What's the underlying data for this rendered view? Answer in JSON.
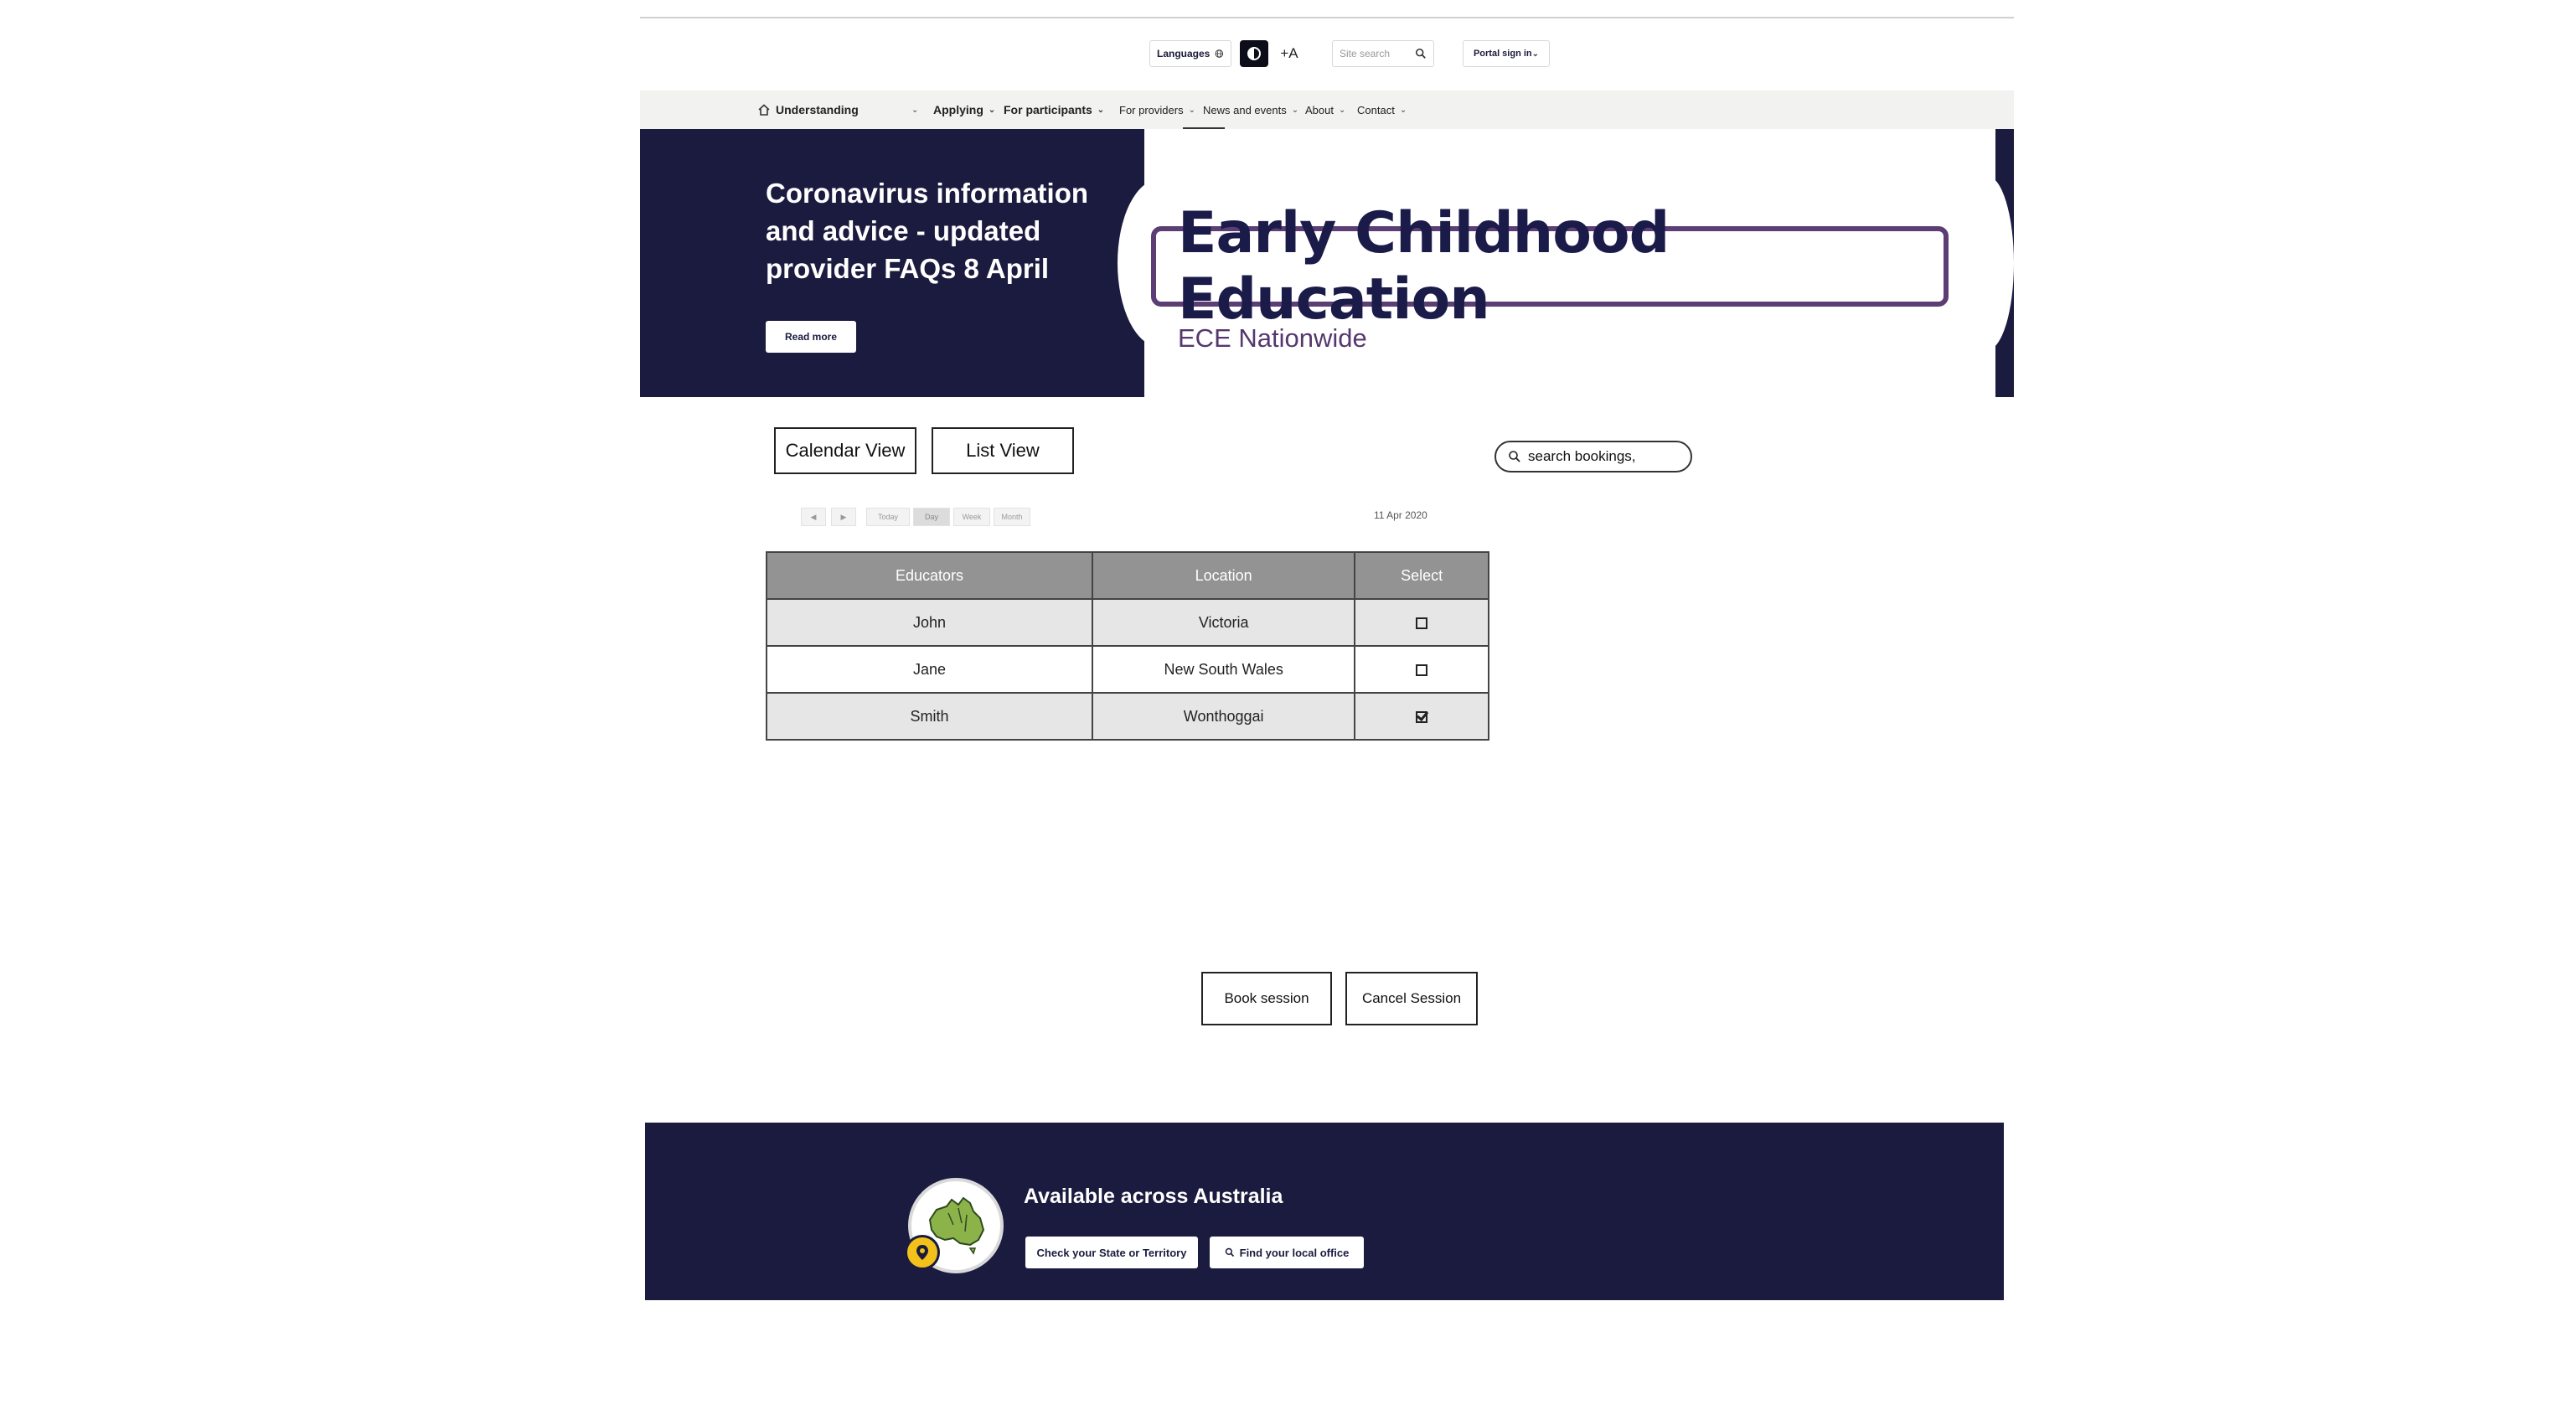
{
  "utility": {
    "languages_label": "Languages",
    "font_size_label": "+A",
    "site_search_placeholder": "Site search",
    "portal_label": "Portal sign in"
  },
  "nav": {
    "items": [
      {
        "label": "Understanding"
      },
      {
        "label": "Applying"
      },
      {
        "label": "For participants"
      },
      {
        "label": "For providers"
      },
      {
        "label": "News and events"
      },
      {
        "label": "About"
      },
      {
        "label": "Contact"
      }
    ]
  },
  "hero": {
    "title": "Coronavirus information and advice - updated provider FAQs 8 April",
    "read_more": "Read more",
    "brand_title": "Early Childhood Education",
    "brand_subtitle": "ECE Nationwide"
  },
  "views": {
    "calendar": "Calendar View",
    "list": "List View",
    "search_value": "search bookings,"
  },
  "calendar": {
    "prev": "◀",
    "next": "▶",
    "today": "Today",
    "day": "Day",
    "week": "Week",
    "month": "Month",
    "date": "11 Apr 2020"
  },
  "table": {
    "headers": [
      "Educators",
      "Location",
      "Select"
    ],
    "rows": [
      {
        "educator": "John",
        "location": "Victoria",
        "selected": false
      },
      {
        "educator": "Jane",
        "location": "New South Wales",
        "selected": false
      },
      {
        "educator": "Smith",
        "location": "Wonthoggai",
        "selected": true
      }
    ]
  },
  "actions": {
    "book": "Book session",
    "cancel": "Cancel Session"
  },
  "footer": {
    "title": "Available across Australia",
    "check_state": "Check your State or Territory",
    "find_office": "Find your local office"
  },
  "colors": {
    "navy": "#1b1b40",
    "purple": "#5c3e74",
    "header_gray": "#939393"
  }
}
